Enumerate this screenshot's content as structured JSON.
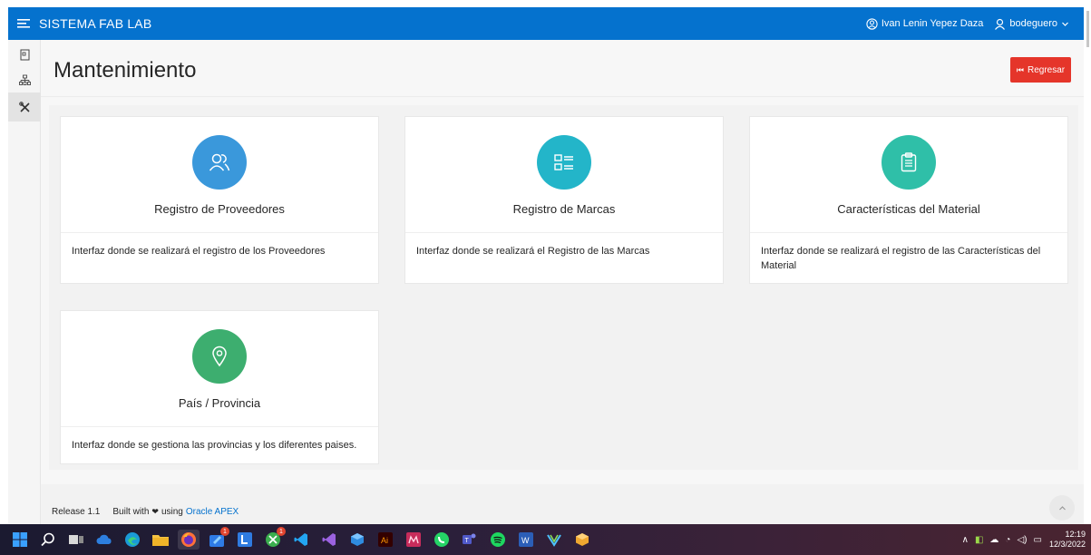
{
  "app": {
    "title": "SISTEMA FAB LAB",
    "user_full_name": "Ivan Lenin Yepez Daza",
    "username": "bodeguero"
  },
  "page": {
    "title": "Mantenimiento",
    "back_button_label": "Regresar"
  },
  "sidenav": {
    "items": [
      {
        "icon": "document-icon",
        "active": false
      },
      {
        "icon": "sitemap-icon",
        "active": false
      },
      {
        "icon": "tools-icon",
        "active": true
      }
    ]
  },
  "cards": [
    {
      "title": "Registro de Proveedores",
      "description": "Interfaz donde se realizará el registro de los Proveedores",
      "icon": "users-icon",
      "color": "#3a98db"
    },
    {
      "title": "Registro de Marcas",
      "description": "Interfaz donde se realizará el Registro de las Marcas",
      "icon": "list-icon",
      "color": "#23b5c9"
    },
    {
      "title": "Características del Material",
      "description": "Interfaz donde se realizará el registro de las Características del Material",
      "icon": "clipboard-icon",
      "color": "#2fbfa8"
    },
    {
      "title": "País / Provincia",
      "description": "Interfaz donde se gestiona las provincias y los diferentes paises.",
      "icon": "map-pin-icon",
      "color": "#3dae6f"
    }
  ],
  "footer": {
    "release": "Release 1.1",
    "built_with": "Built with",
    "using": "using",
    "link": "Oracle APEX"
  },
  "taskbar": {
    "time": "12:19",
    "date": "12/3/2022",
    "badges": [
      "1",
      "1"
    ]
  },
  "colors": {
    "header": "#0572ce",
    "back_button": "#e5352a"
  }
}
